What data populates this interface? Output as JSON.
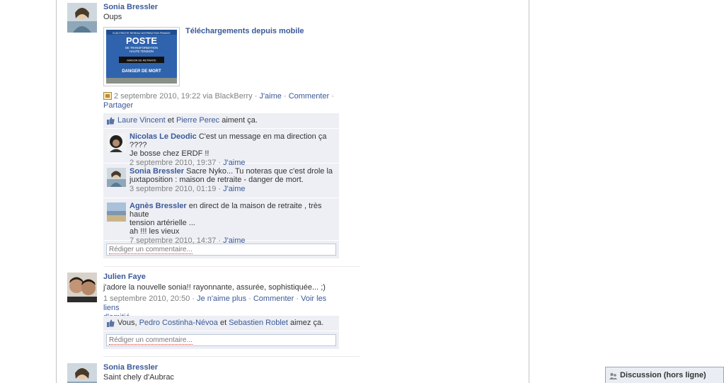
{
  "posts": [
    {
      "author": "Sonia Bressler",
      "text": "Oups",
      "attachment_title": "Téléchargements depuis mobile",
      "attachment_sign": {
        "top": "ELECTRICITE RESEAU DISTRIBUTION FRANCE",
        "main": "POSTE",
        "sub1": "DE TRANSFORMATION",
        "sub2": "HAUTE TENSION",
        "plate": "MAISON DE RETRAITE",
        "danger": "DANGER DE MORT"
      },
      "meta_line1": "2 septembre 2010, 19:22 via BlackBerry",
      "actions": {
        "like": "J'aime",
        "comment": "Commenter",
        "share": "Partager"
      },
      "likes": {
        "user1": "Laure Vincent",
        "and": "et",
        "user2": "Pierre Perec",
        "suffix": "aiment ça."
      },
      "comments": [
        {
          "author": "Nicolas Le Deodic",
          "text": "C'est un message en ma direction ça ????",
          "text2": "Je bosse chez ERDF !!",
          "date": "2 septembre 2010, 19:37",
          "like": "J'aime"
        },
        {
          "author": "Sonia Bressler",
          "text": "Sacre Nyko... Tu noteras que c'est drole la",
          "text2": "juxtaposition : maison de retraite - danger de mort.",
          "date": "3 septembre 2010, 01:19",
          "like": "J'aime"
        },
        {
          "author": "Agnès Bressler",
          "text": "en direct de la maison de retraite , très haute",
          "text2": "tension artérielle ...",
          "text3": "ah !!! les vieux",
          "date": "7 septembre 2010, 14:37",
          "like": "J'aime"
        }
      ],
      "comment_placeholder": "Rédiger un commentaire..."
    },
    {
      "author": "Julien Faye",
      "text": "j'adore la nouvelle sonia!! rayonnante, assurée, sophistiquée... ;)",
      "meta_date": "1 septembre 2010, 20:50",
      "actions": {
        "unlike": "Je n'aime plus",
        "comment": "Commenter",
        "friendship": "Voir les liens",
        "friendship2": "d'amitié"
      },
      "likes": {
        "prefix": "Vous,",
        "user1": "Pedro Costinha-Névoa",
        "and": "et",
        "user2": "Sebastien Roblet",
        "suffix": "aimez ça."
      },
      "comment_placeholder": "Rédiger un commentaire..."
    },
    {
      "author": "Sonia Bressler",
      "text": "Saint chely d'Aubrac"
    }
  ],
  "chat": {
    "label": "Discussion (hors ligne)"
  },
  "colors": {
    "link": "#3b5998",
    "ufi_bg": "#edeff4",
    "muted": "#808080"
  }
}
